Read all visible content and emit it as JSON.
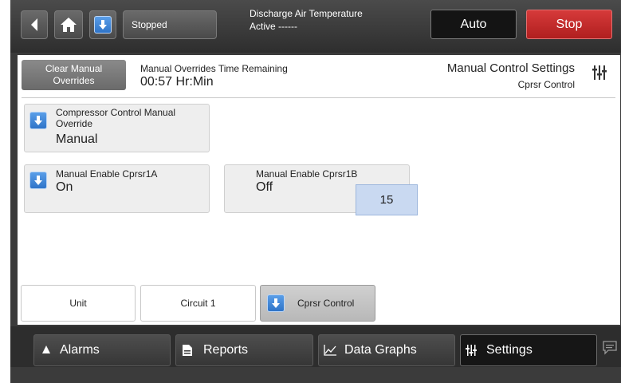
{
  "topbar": {
    "status": "Stopped",
    "alarm_title": "Discharge Air Temperature",
    "alarm_state": "Active ------",
    "auto_label": "Auto",
    "stop_label": "Stop"
  },
  "header": {
    "clear_line1": "Clear Manual",
    "clear_line2": "Overrides",
    "overrides_label": "Manual Overrides Time Remaining",
    "overrides_value": "00:57 Hr:Min",
    "title": "Manual Control Settings",
    "subtitle": "Cprsr Control"
  },
  "cards": {
    "compressor": {
      "label_line1": "Compressor Control Manual",
      "label_line2": "Override",
      "value": "Manual"
    },
    "cprsr1a": {
      "label": "Manual Enable Cprsr1A",
      "value": "On"
    },
    "cprsr1b": {
      "label": "Manual Enable Cprsr1B",
      "value": "Off"
    }
  },
  "badge": "15",
  "tabs": [
    "Unit",
    "Circuit 1",
    "Cprsr Control"
  ],
  "nav": {
    "alarms": "Alarms",
    "reports": "Reports",
    "data_graphs": "Data Graphs",
    "settings": "Settings"
  },
  "colors": {
    "stop": "#c62a2a",
    "accent_blue": "#3b82d6",
    "badge": "#c9d9f1"
  }
}
